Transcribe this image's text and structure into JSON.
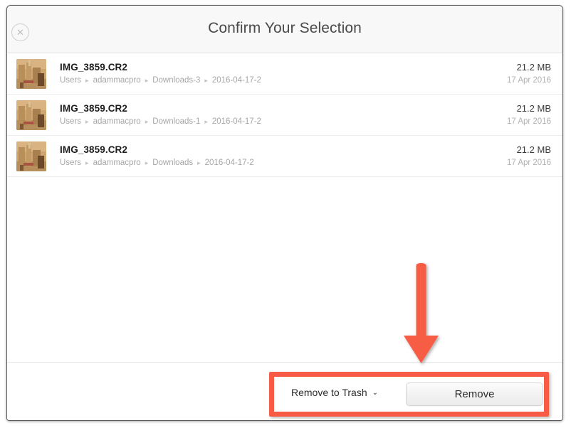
{
  "window": {
    "header": {
      "title": "Confirm Your Selection",
      "close_icon": "close-circle-icon"
    }
  },
  "file_list": {
    "rows": [
      {
        "name": "IMG_3859.CR2",
        "breadcrumb": [
          "Users",
          "adammacpro",
          "Downloads-3",
          "2016-04-17-2"
        ],
        "size": "21.2 MB",
        "date": "17 Apr 2016",
        "thumbnail_icon": "photo-thumbnail"
      },
      {
        "name": "IMG_3859.CR2",
        "breadcrumb": [
          "Users",
          "adammacpro",
          "Downloads-1",
          "2016-04-17-2"
        ],
        "size": "21.2 MB",
        "date": "17 Apr 2016",
        "thumbnail_icon": "photo-thumbnail"
      },
      {
        "name": "IMG_3859.CR2",
        "breadcrumb": [
          "Users",
          "adammacpro",
          "Downloads",
          "2016-04-17-2"
        ],
        "size": "21.2 MB",
        "date": "17 Apr 2016",
        "thumbnail_icon": "photo-thumbnail"
      }
    ],
    "breadcrumb_separator": "▸"
  },
  "footer": {
    "action_dropdown_label": "Remove to Trash",
    "dropdown_chevron": "⌄",
    "remove_button_label": "Remove"
  },
  "annotations": {
    "arrow_color": "#f75b45",
    "highlight_color": "#f75b45"
  }
}
